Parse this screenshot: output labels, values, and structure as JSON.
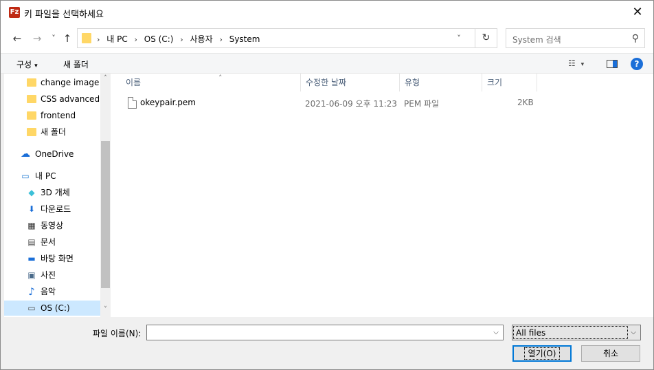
{
  "window": {
    "title": "키 파일을 선택하세요",
    "app_icon_text": "Fz",
    "close_glyph": "✕"
  },
  "nav": {
    "back": "←",
    "forward": "→",
    "recent": "˅",
    "up": "↑",
    "breadcrumbs": [
      "내 PC",
      "OS (C:)",
      "사용자",
      "System"
    ],
    "crumb_sep": "›",
    "dropdown": "˅",
    "refresh": "↻",
    "search_placeholder": "System 검색",
    "search_icon_glyph": "⚲"
  },
  "toolbar": {
    "organize_label": "구성",
    "new_folder_label": "새 폴더",
    "view_glyph": "☷",
    "caret": "▾",
    "help_label": "?"
  },
  "tree": {
    "items": [
      {
        "label": "change image c",
        "icon": "folder-icon"
      },
      {
        "label": "CSS advanced",
        "icon": "folder-icon"
      },
      {
        "label": "frontend",
        "icon": "folder-icon"
      },
      {
        "label": "새 폴더",
        "icon": "folder-icon"
      },
      {
        "label": "OneDrive",
        "icon": "cloud-icon",
        "glyph": "☁"
      },
      {
        "label": "내 PC",
        "icon": "computer-icon",
        "glyph": "▭"
      },
      {
        "label": "3D 개체",
        "icon": "cube-icon",
        "glyph": "◆"
      },
      {
        "label": "다운로드",
        "icon": "download-arrow-icon",
        "glyph": "⬇"
      },
      {
        "label": "동영상",
        "icon": "film-icon",
        "glyph": "▦"
      },
      {
        "label": "문서",
        "icon": "document-icon",
        "glyph": "▤"
      },
      {
        "label": "바탕 화면",
        "icon": "desktop-icon",
        "glyph": "▬"
      },
      {
        "label": "사진",
        "icon": "picture-icon",
        "glyph": "▣"
      },
      {
        "label": "음악",
        "icon": "music-icon",
        "glyph": "♪"
      },
      {
        "label": "OS (C:)",
        "icon": "drive-icon",
        "glyph": "▭",
        "selected": true
      }
    ],
    "scroll_up": "˄",
    "scroll_down": "˅"
  },
  "list": {
    "columns": [
      "이름",
      "수정한 날짜",
      "유형",
      "크기"
    ],
    "sort_caret": "˄",
    "rows": [
      {
        "name": "okeypair.pem",
        "modified": "2021-06-09 오후 11:23",
        "type": "PEM 파일",
        "size": "2KB"
      }
    ]
  },
  "footer": {
    "filename_label": "파일 이름(N):",
    "filename_value": "",
    "filetype_value": "All files",
    "dd_glyph": "⌵",
    "open_label": "열기(O)",
    "cancel_label": "취소"
  },
  "colors": {
    "accent": "#0078d7",
    "folder": "#ffd766",
    "selection": "#cce8ff",
    "app_icon": "#bf2a14"
  }
}
